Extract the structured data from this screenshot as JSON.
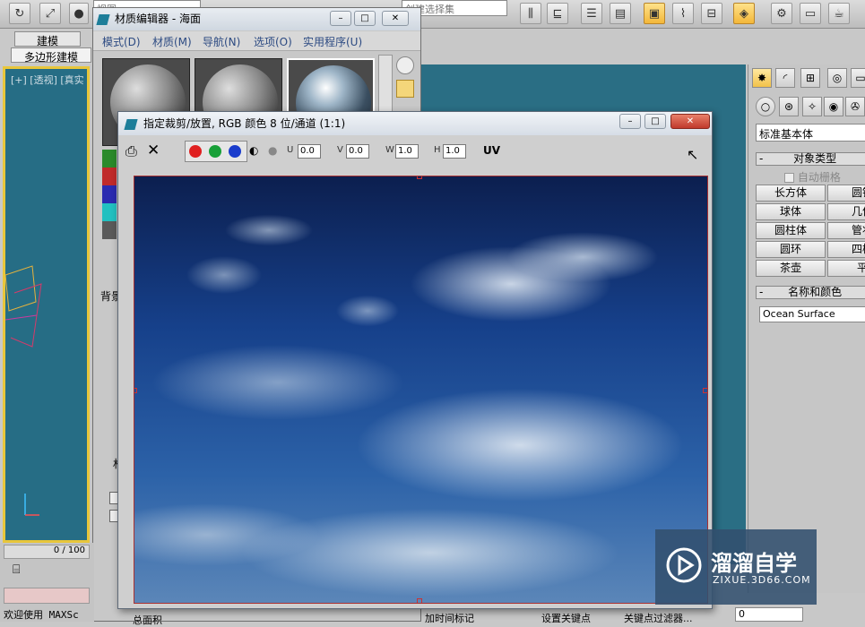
{
  "toolbar": {
    "view_combo": "视图",
    "selset_combo": "创建选择集"
  },
  "ribbon": {
    "tab_modeling": "建模",
    "tab_poly": "多边形建模"
  },
  "viewport": {
    "label": "[+] [透视] [真实"
  },
  "timeslider": {
    "frame": "0 / 100"
  },
  "status": {
    "welcome": "欢迎使用 MAXSc"
  },
  "bottom": {
    "total": "总面积",
    "time_tag": "加时间标记",
    "set_key": "设置关键点",
    "key_filter": "关键点过滤器...",
    "frame_value": "0"
  },
  "mat_editor": {
    "title": "材质编辑器 - 海面",
    "menu": [
      "模式(D)",
      "材质(M)",
      "导航(N)",
      "选项(O)",
      "实用程序(U)"
    ],
    "side_labels": {
      "bg": "背景",
      "ma": "材"
    }
  },
  "crop_dialog": {
    "title": "指定裁剪/放置, RGB 颜色 8 位/通道 (1:1)",
    "u_label": "U",
    "u_value": "0.0",
    "v_label": "V",
    "v_value": "0.0",
    "w_label": "W",
    "w_value": "1.0",
    "h_label": "H",
    "h_value": "1.0",
    "uv_label": "UV",
    "colors": {
      "red": "#e02020",
      "green": "#18a038",
      "blue": "#1a3ccc"
    }
  },
  "command_panel": {
    "category": "标准基本体",
    "object_type_header": "对象类型",
    "autogrid": "自动栅格",
    "buttons": [
      [
        "长方体",
        "圆锥"
      ],
      [
        "球体",
        "几何"
      ],
      [
        "圆柱体",
        "管状"
      ],
      [
        "圆环",
        "四棱"
      ],
      [
        "茶壶",
        "平"
      ]
    ],
    "name_color_header": "名称和颜色",
    "object_name": "Ocean Surface"
  },
  "watermark": {
    "brand": "溜溜自学",
    "url": "ZIXUE.3D66.COM"
  }
}
